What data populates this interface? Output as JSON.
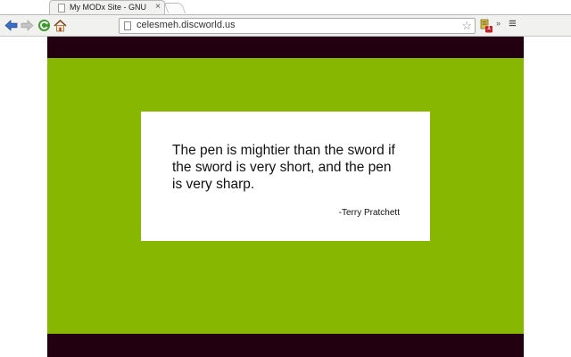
{
  "browser": {
    "tab": {
      "title": "My MODx Site - GNU",
      "close_glyph": "×"
    },
    "toolbar": {
      "url": "celesmeh.discworld.us",
      "star_glyph": "☆",
      "menu_glyph": "≡",
      "overflow_glyph": "»",
      "extension_badge": "1"
    }
  },
  "page": {
    "colors": {
      "background": "#88b700",
      "bars": "#22000f",
      "card": "#ffffff"
    },
    "quote": {
      "text": "The pen is mightier than the sword if the sword is very short, and the pen is very sharp.",
      "author": "-Terry Pratchett"
    }
  }
}
